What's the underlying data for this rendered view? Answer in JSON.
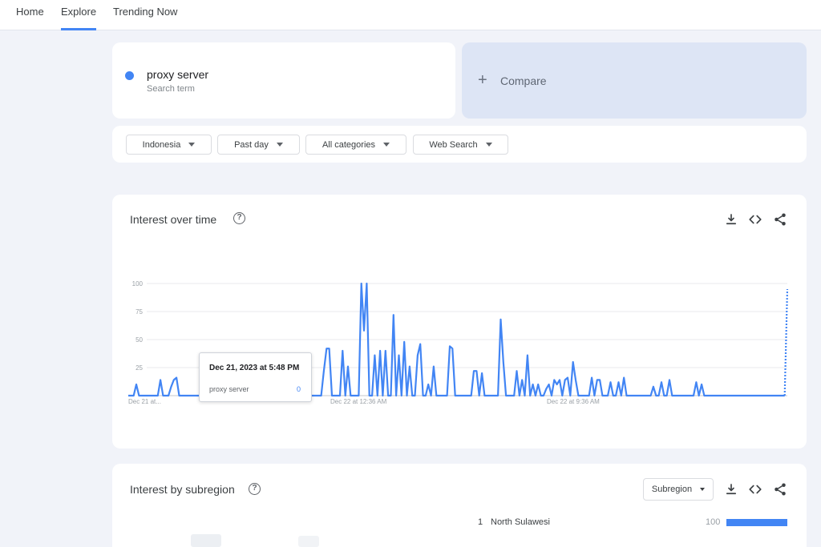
{
  "nav": {
    "tabs": [
      {
        "label": "Home"
      },
      {
        "label": "Explore"
      },
      {
        "label": "Trending Now"
      }
    ]
  },
  "search": {
    "term": "proxy server",
    "term_subtitle": "Search term",
    "term_color": "#4285f4",
    "compare_label": "Compare"
  },
  "filters": {
    "region": "Indonesia",
    "time": "Past day",
    "category": "All categories",
    "search_type": "Web Search"
  },
  "interest_over_time": {
    "title": "Interest over time",
    "tooltip": {
      "date": "Dec 21, 2023 at 5:48 PM",
      "term": "proxy server",
      "value": "0"
    }
  },
  "interest_by_subregion": {
    "title": "Interest by subregion",
    "resolution_label": "Subregion",
    "rows": [
      {
        "rank": "1",
        "name": "North Sulawesi",
        "value": "100",
        "value_num": 100
      }
    ]
  },
  "icons": {
    "download": "download-icon",
    "embed": "embed-code-icon",
    "share": "share-icon",
    "help": "help-icon",
    "compare": "plus-icon"
  },
  "chart_data": {
    "type": "line",
    "series": [
      {
        "name": "proxy server",
        "color": "#4285f4",
        "values": [
          0,
          0,
          0,
          10,
          0,
          0,
          0,
          0,
          0,
          0,
          0,
          0,
          14,
          0,
          0,
          0,
          8,
          14,
          16,
          0,
          0,
          0,
          0,
          0,
          0,
          0,
          0,
          0,
          0,
          0,
          0,
          0,
          0,
          0,
          0,
          0,
          0,
          0,
          0,
          0,
          0,
          0,
          0,
          0,
          0,
          0,
          0,
          0,
          0,
          0,
          0,
          0,
          0,
          20,
          10,
          0,
          0,
          26,
          0,
          18,
          30,
          12,
          22,
          34,
          14,
          22,
          24,
          0,
          0,
          0,
          0,
          0,
          0,
          22,
          42,
          42,
          0,
          0,
          0,
          0,
          40,
          0,
          26,
          0,
          0,
          0,
          0,
          100,
          58,
          100,
          0,
          0,
          36,
          0,
          40,
          0,
          40,
          0,
          0,
          72,
          0,
          36,
          0,
          48,
          0,
          26,
          0,
          0,
          36,
          46,
          0,
          0,
          10,
          0,
          26,
          0,
          0,
          0,
          0,
          0,
          44,
          42,
          0,
          0,
          0,
          0,
          0,
          0,
          0,
          22,
          22,
          0,
          20,
          0,
          0,
          0,
          0,
          0,
          0,
          68,
          30,
          0,
          0,
          0,
          0,
          22,
          0,
          14,
          0,
          36,
          0,
          10,
          0,
          10,
          0,
          0,
          6,
          10,
          0,
          14,
          10,
          14,
          0,
          14,
          16,
          0,
          30,
          14,
          0,
          0,
          0,
          0,
          0,
          16,
          0,
          14,
          14,
          0,
          0,
          0,
          12,
          0,
          0,
          12,
          0,
          16,
          0,
          0,
          0,
          0,
          0,
          0,
          0,
          0,
          0,
          0,
          8,
          0,
          0,
          12,
          0,
          0,
          14,
          0,
          0,
          0,
          0,
          0,
          0,
          0,
          0,
          0,
          12,
          0,
          10,
          0,
          0,
          0,
          0,
          0,
          0,
          0,
          0,
          0,
          0,
          0,
          0,
          0,
          0,
          0,
          0,
          0,
          0,
          0,
          0,
          0,
          0,
          0,
          0,
          0,
          0,
          0,
          0,
          0,
          0,
          0,
          95
        ],
        "partial_last": true
      }
    ],
    "x_tick_labels": [
      "Dec 21 at...",
      "Dec 22 at 12:36 AM",
      "Dec 22 at 9:36 AM"
    ],
    "y_ticks": [
      0,
      25,
      50,
      75,
      100
    ],
    "y_tick_labels": [
      "",
      "25",
      "50",
      "75",
      "100"
    ],
    "ylim": [
      0,
      100
    ],
    "grid": true,
    "legend": "none"
  }
}
